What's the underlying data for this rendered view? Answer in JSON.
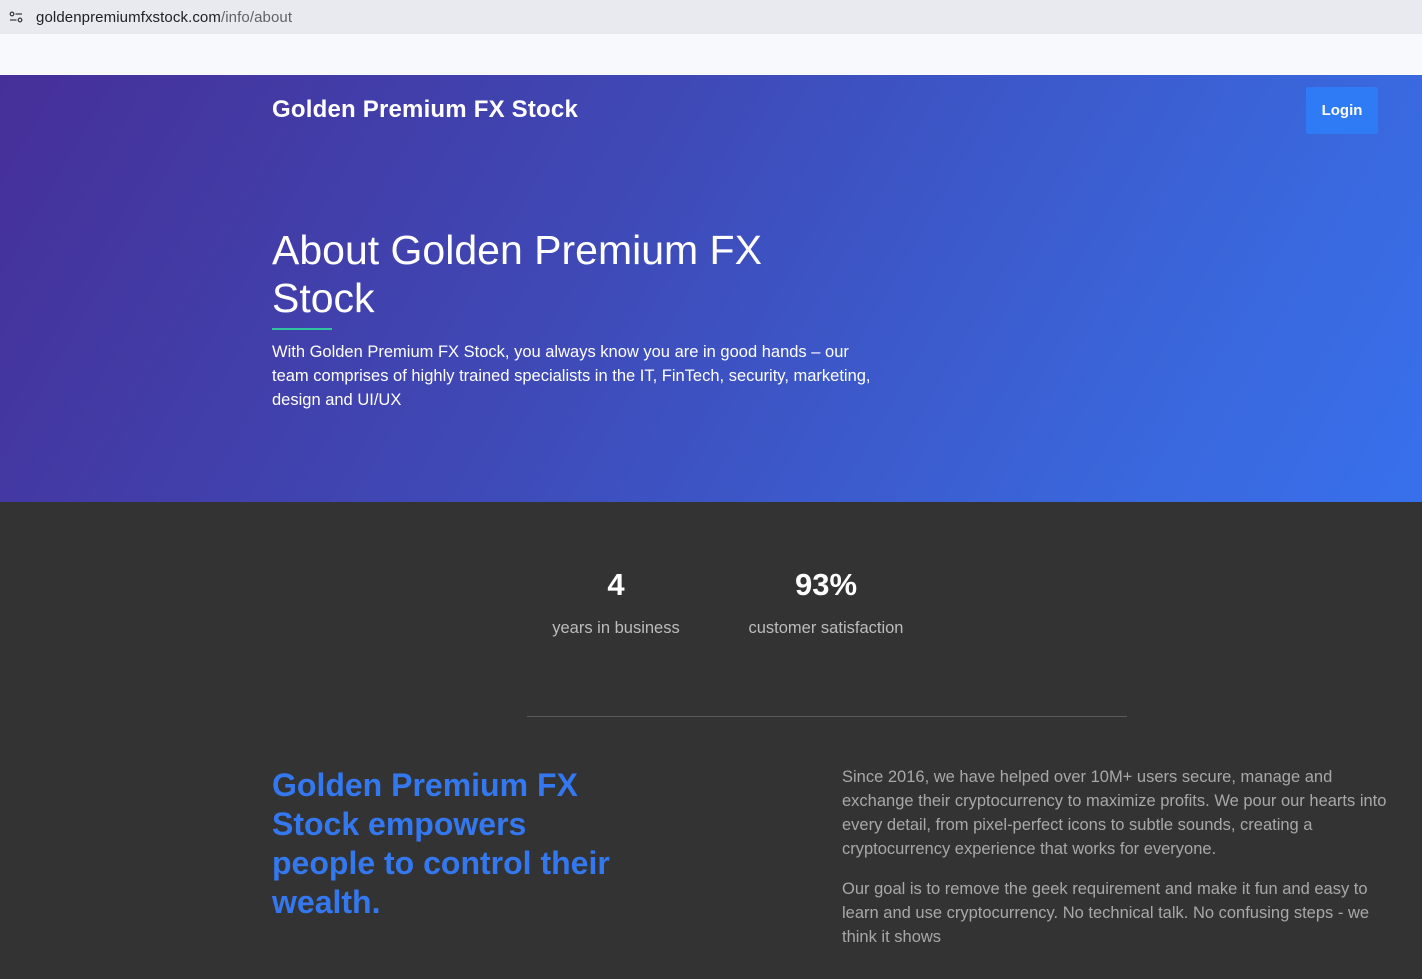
{
  "browser": {
    "url_domain": "goldenpremiumfxstock.com",
    "url_path": "/info/about",
    "site_info_icon": "tune-icon"
  },
  "header": {
    "brand": "Golden Premium FX Stock",
    "login_label": "Login"
  },
  "hero": {
    "title": "About Golden Premium FX Stock",
    "description": "With Golden Premium FX Stock, you always know you are in good hands – our team comprises of highly trained specialists in the IT, FinTech, security, marketing, design and UI/UX"
  },
  "stats": [
    {
      "value": "4",
      "label": "years in business"
    },
    {
      "value": "93%",
      "label": "customer satisfaction"
    }
  ],
  "about": {
    "tagline": "Golden Premium FX Stock empowers people to control their wealth.",
    "paragraphs": [
      "Since 2016, we have helped over 10M+ users secure, manage and exchange their cryptocurrency to maximize profits. We pour our hearts into every detail, from pixel-perfect icons to subtle sounds, creating a cryptocurrency experience that works for everyone.",
      "Our goal is to remove the geek requirement and make it fun and easy to learn and use cryptocurrency. No technical talk. No confusing steps - we think it shows"
    ]
  },
  "colors": {
    "hero_gradient_start": "#462f98",
    "hero_gradient_end": "#3870ec",
    "login_button": "#2f7bf5",
    "accent_underline": "#30c3a0",
    "tagline": "#3478f0",
    "dark_background": "#333333"
  }
}
